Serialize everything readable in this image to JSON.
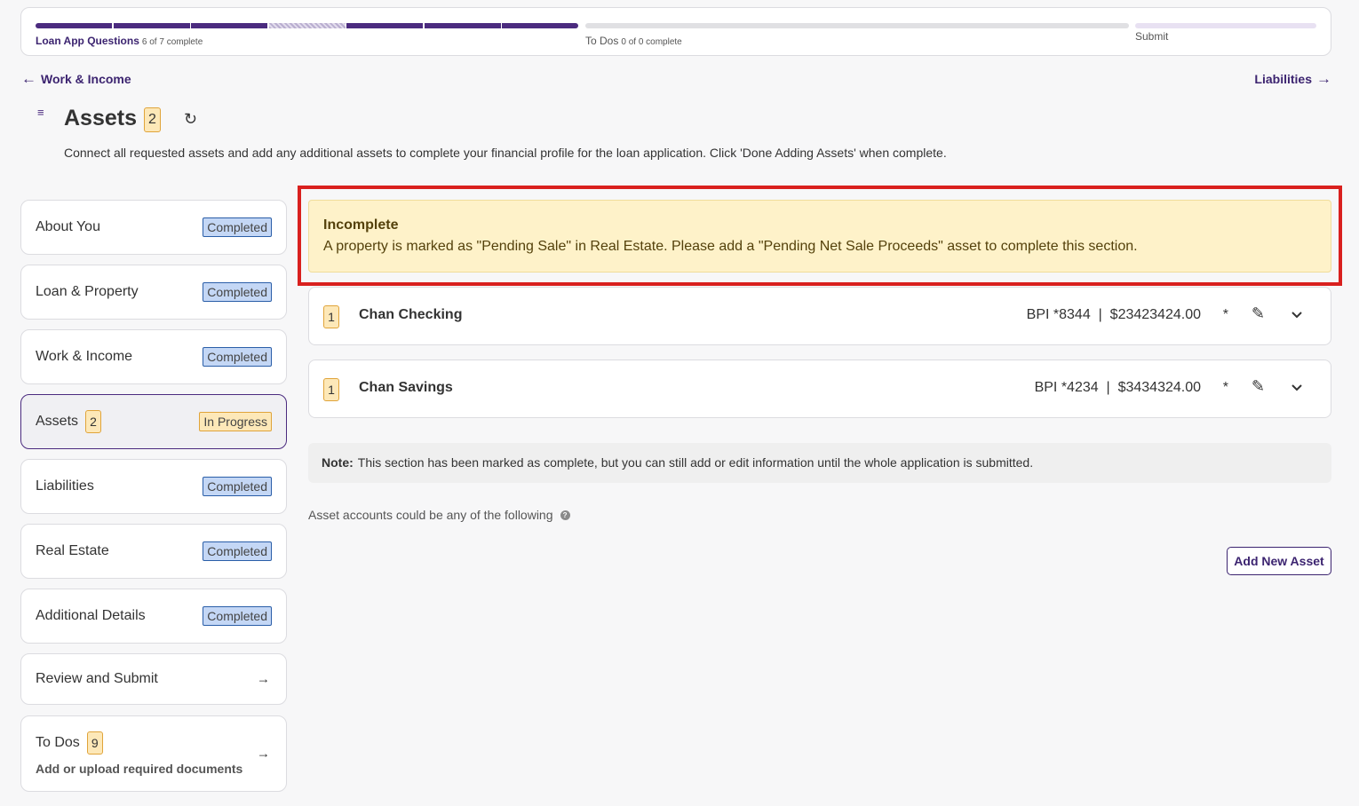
{
  "progress": {
    "questions_label": "Loan App Questions",
    "questions_count": "6 of 7 complete",
    "todos_label": "To Dos",
    "todos_count": "0 of 0 complete",
    "submit_label": "Submit",
    "questions_completed": 6,
    "questions_total": 7
  },
  "nav": {
    "back_label": "Work & Income",
    "forward_label": "Liabilities"
  },
  "header": {
    "title": "Assets",
    "badge": "2",
    "description": "Connect all requested assets and add any additional assets to complete your financial profile for the loan application. Click 'Done Adding Assets' when complete."
  },
  "sidebar": {
    "items": [
      {
        "label": "About You",
        "status": "Completed"
      },
      {
        "label": "Loan & Property",
        "status": "Completed"
      },
      {
        "label": "Work & Income",
        "status": "Completed"
      },
      {
        "label": "Assets",
        "badge": "2",
        "status": "In Progress"
      },
      {
        "label": "Liabilities",
        "status": "Completed"
      },
      {
        "label": "Real Estate",
        "status": "Completed"
      },
      {
        "label": "Additional Details",
        "status": "Completed"
      },
      {
        "label": "Review and Submit"
      },
      {
        "label": "To Dos",
        "badge": "9",
        "subtitle": "Add or upload required documents"
      }
    ]
  },
  "alert": {
    "title": "Incomplete",
    "text": "A property is marked as \"Pending Sale\" in Real Estate. Please add a \"Pending Net Sale Proceeds\" asset to complete this section."
  },
  "assets": [
    {
      "badge": "1",
      "name": "Chan Checking",
      "info": "BPI *8344  |  $23423424.00",
      "star": "*"
    },
    {
      "badge": "1",
      "name": "Chan Savings",
      "info": "BPI *4234  |  $3434324.00",
      "star": "*"
    }
  ],
  "note": {
    "label": "Note:",
    "text": "This section has been marked as complete, but you can still add or edit information until the whole application is submitted."
  },
  "hint": {
    "text": "Asset accounts could be any of the following"
  },
  "add_button": "Add New Asset",
  "colors": {
    "primary": "#4b2b7f",
    "alert_border": "#d9201e",
    "alert_bg": "#fef2c9",
    "completed_bg": "#c4d7f5",
    "in_progress_bg": "#fde8b8"
  }
}
